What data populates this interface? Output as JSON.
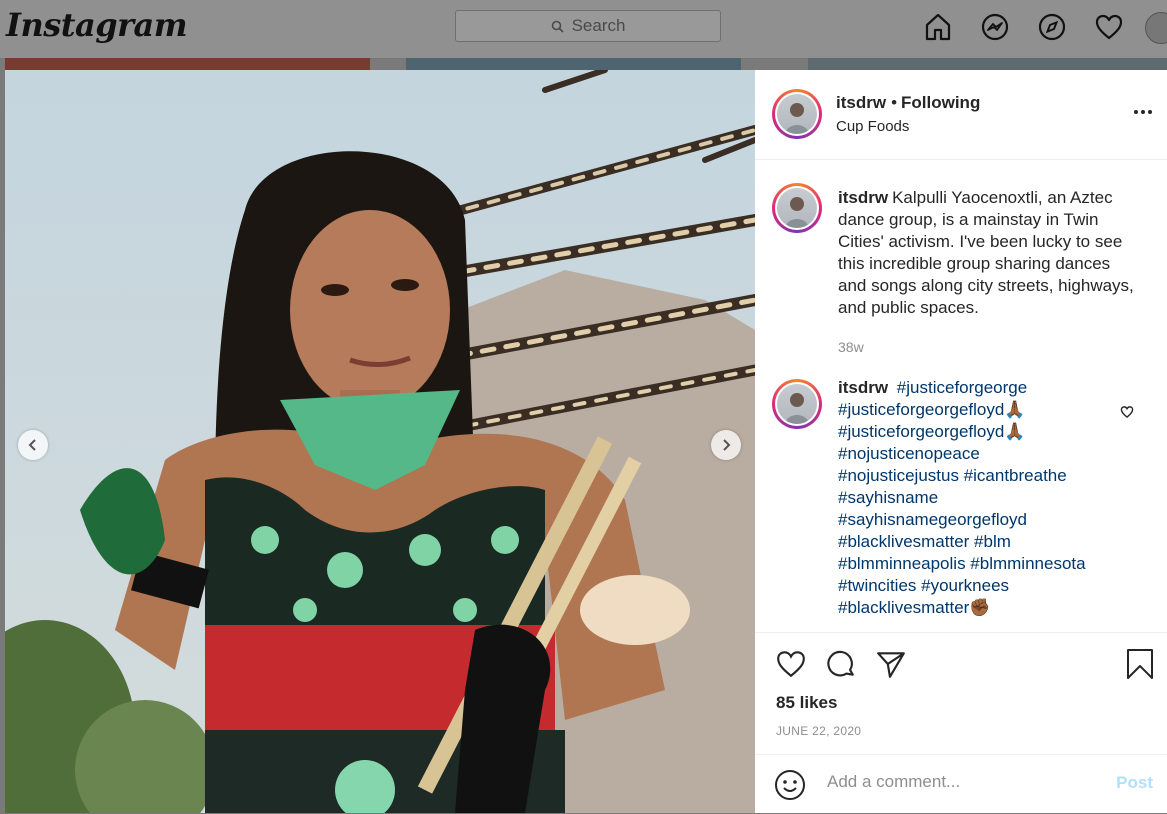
{
  "topnav": {
    "logo": "Instagram",
    "search_placeholder": "Search",
    "icons": [
      "home-icon",
      "messenger-icon",
      "explore-icon",
      "activity-heart-icon",
      "profile-avatar"
    ]
  },
  "post": {
    "username": "itsdrw",
    "follow_status": "Following",
    "location": "Cup Foods",
    "more_icon": "more-options-icon",
    "caption": {
      "username": "itsdrw",
      "text": "Kalpulli Yaocenoxtli, an Aztec dance group, is a mainstay in Twin Cities' activism. I've been lucky to see this incredible group sharing dances and songs along city streets, highways, and public spaces.",
      "time": "38w"
    },
    "comment": {
      "username": "itsdrw",
      "lines": [
        "#justiceforgeorge",
        "#justiceforgeorgefloyd🙏🏾",
        "#justiceforgeorgefloyd🙏🏾",
        "#nojusticenopeace",
        "#nojusticejustus #icantbreathe",
        "#sayhisname",
        "#sayhisnamegeorgefloyd",
        "#blacklivesmatter #blm",
        "#blmminneapolis #blmminnesota",
        "#twincities #yourknees",
        "#blacklivesmatter✊🏾"
      ]
    },
    "likes": "85 likes",
    "date": "JUNE 22, 2020",
    "comment_placeholder": "Add a comment...",
    "post_label": "Post"
  },
  "colors": {
    "link": "#00376b",
    "text": "#262626",
    "muted": "#8e8e8e",
    "post_disabled": "#b2dffc"
  }
}
